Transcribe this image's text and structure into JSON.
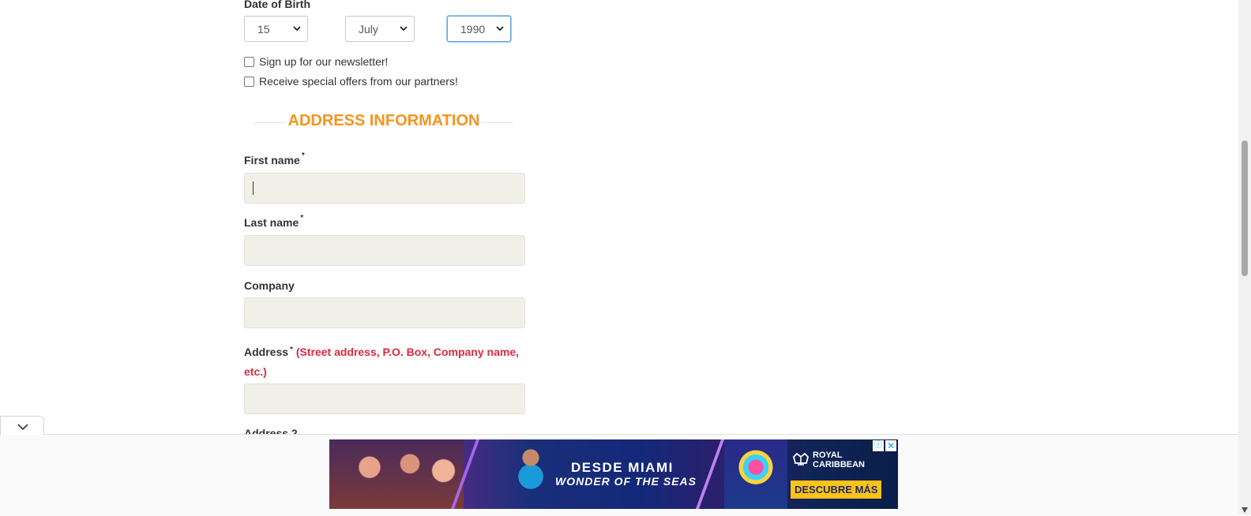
{
  "dob": {
    "label": "Date of Birth",
    "day": "15",
    "month": "July",
    "year": "1990"
  },
  "checkboxes": {
    "newsletter": "Sign up for our newsletter!",
    "partners": "Receive special offers from our partners!"
  },
  "section": {
    "title": "ADDRESS INFORMATION"
  },
  "fields": {
    "first_name": {
      "label": "First name",
      "required": "*"
    },
    "last_name": {
      "label": "Last name",
      "required": "*"
    },
    "company": {
      "label": "Company"
    },
    "address": {
      "label": "Address",
      "required": "*",
      "hint": "(Street address, P.O. Box, Company name, etc.)"
    },
    "address2": {
      "label": "Address 2"
    }
  },
  "ad": {
    "line1": "DESDE MIAMI",
    "line2": "WONDER OF THE SEAS",
    "brand_line1": "ROYAL",
    "brand_line2": "CARIBBEAN",
    "cta": "DESCUBRE MÁS",
    "adchoices": "ⓘ",
    "close": "✕"
  },
  "colors": {
    "section_title": "#f7931e",
    "hint": "#e0283f",
    "field_bg": "#f0efe8"
  }
}
